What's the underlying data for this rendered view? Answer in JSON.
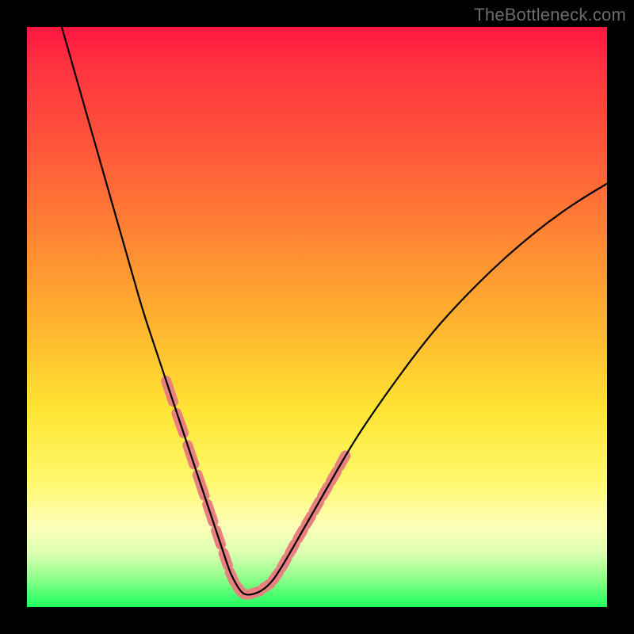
{
  "watermark": "TheBottleneck.com",
  "chart_data": {
    "type": "line",
    "title": "",
    "xlabel": "",
    "ylabel": "",
    "xlim": [
      0,
      100
    ],
    "ylim": [
      0,
      100
    ],
    "series": [
      {
        "name": "bottleneck-curve",
        "x": [
          6,
          8,
          10,
          12,
          14,
          16,
          18,
          20,
          22,
          24,
          26,
          28,
          30,
          32,
          33,
          34,
          35,
          36,
          37,
          38,
          40,
          42,
          44,
          46,
          48,
          52,
          56,
          60,
          65,
          70,
          75,
          80,
          85,
          90,
          95,
          100
        ],
        "y": [
          100,
          93,
          86,
          79,
          72,
          65,
          58,
          51,
          45,
          39,
          33,
          27,
          21,
          15,
          12,
          9,
          6,
          4,
          2.5,
          2,
          2.5,
          4,
          7,
          10.5,
          14,
          21,
          28,
          34,
          41,
          47.5,
          53,
          58,
          62.5,
          66.5,
          70,
          73
        ]
      }
    ],
    "markers": {
      "name": "highlight-dashes",
      "color": "#e98080",
      "segments": [
        {
          "x1": 24.0,
          "y1": 39.0,
          "x2": 25.2,
          "y2": 35.4
        },
        {
          "x1": 25.8,
          "y1": 33.4,
          "x2": 27.0,
          "y2": 30.0
        },
        {
          "x1": 27.7,
          "y1": 27.9,
          "x2": 28.8,
          "y2": 24.6
        },
        {
          "x1": 29.4,
          "y1": 22.8,
          "x2": 30.6,
          "y2": 19.2
        },
        {
          "x1": 31.1,
          "y1": 17.7,
          "x2": 32.1,
          "y2": 14.7
        },
        {
          "x1": 32.6,
          "y1": 13.2,
          "x2": 33.4,
          "y2": 10.8
        },
        {
          "x1": 33.9,
          "y1": 9.3,
          "x2": 34.6,
          "y2": 7.2
        },
        {
          "x1": 35.0,
          "y1": 6.0,
          "x2": 35.7,
          "y2": 4.4
        },
        {
          "x1": 36.2,
          "y1": 3.6,
          "x2": 37.0,
          "y2": 2.5
        },
        {
          "x1": 37.5,
          "y1": 2.2,
          "x2": 38.5,
          "y2": 2.2
        },
        {
          "x1": 39.0,
          "y1": 2.4,
          "x2": 40.2,
          "y2": 2.8
        },
        {
          "x1": 40.8,
          "y1": 3.3,
          "x2": 41.9,
          "y2": 4.0
        },
        {
          "x1": 42.4,
          "y1": 4.6,
          "x2": 43.4,
          "y2": 6.0
        },
        {
          "x1": 43.9,
          "y1": 6.8,
          "x2": 44.8,
          "y2": 8.4
        },
        {
          "x1": 45.3,
          "y1": 9.3,
          "x2": 46.2,
          "y2": 10.9
        },
        {
          "x1": 46.7,
          "y1": 11.8,
          "x2": 47.6,
          "y2": 13.3
        },
        {
          "x1": 48.1,
          "y1": 14.2,
          "x2": 49.0,
          "y2": 15.7
        },
        {
          "x1": 49.5,
          "y1": 16.6,
          "x2": 50.4,
          "y2": 18.2
        },
        {
          "x1": 50.9,
          "y1": 19.1,
          "x2": 51.9,
          "y2": 20.8
        },
        {
          "x1": 52.4,
          "y1": 21.7,
          "x2": 53.4,
          "y2": 23.4
        },
        {
          "x1": 53.9,
          "y1": 24.3,
          "x2": 54.9,
          "y2": 26.1
        }
      ]
    }
  }
}
